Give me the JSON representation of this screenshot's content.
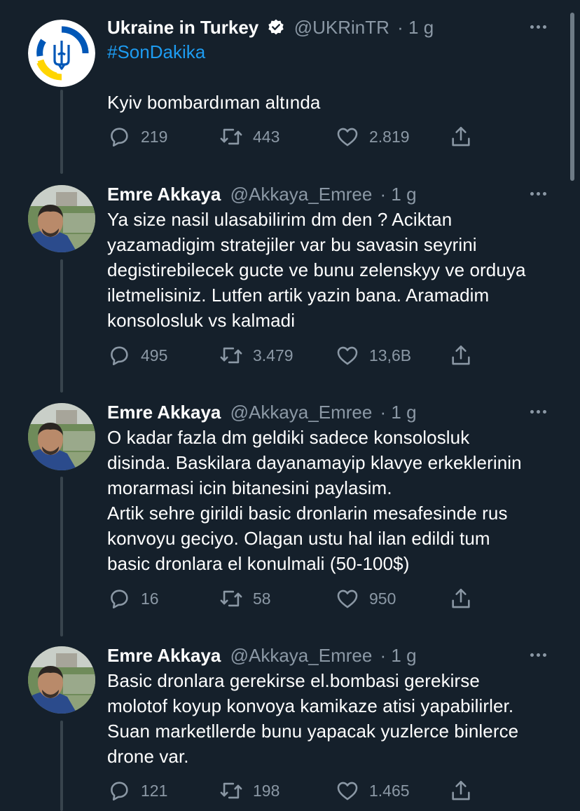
{
  "tweets": [
    {
      "author": "Ukraine in Turkey",
      "handle": "@UKRinTR",
      "time": "· 1 g",
      "verified": true,
      "hashtag": "#SonDakika",
      "text": "Kyiv bombardıman altında",
      "replies": "219",
      "retweets": "443",
      "likes": "2.819",
      "avatar": "ukraine-trident-icon"
    },
    {
      "author": "Emre Akkaya",
      "handle": "@Akkaya_Emree",
      "time": "· 1 g",
      "text": "Ya size nasil ulasabilirim dm den ? Aciktan\nyazamadigim stratejiler var bu savasin seyrini\ndegistirebilecek gucte ve bunu zelenskyy ve orduya\niletmelisiniz. Lutfen artik yazin bana.  Aramadim\nkonsolosluk vs kalmadi",
      "replies": "495",
      "retweets": "3.479",
      "likes": "13,6B"
    },
    {
      "author": "Emre Akkaya",
      "handle": "@Akkaya_Emree",
      "time": "· 1 g",
      "text": "O kadar fazla dm geldiki sadece konsolosluk\ndisinda. Baskilara dayanamayip klavye erkeklerinin\nmorarmasi icin bitanesini paylasim.\nArtik sehre girildi basic dronlarin mesafesinde rus\nkonvoyu geciyo. Olagan ustu hal ilan edildi tum\nbasic dronlara el konulmali (50-100$)",
      "replies": "16",
      "retweets": "58",
      "likes": "950"
    },
    {
      "author": "Emre Akkaya",
      "handle": "@Akkaya_Emree",
      "time": "· 1 g",
      "text": "Basic dronlara gerekirse el.bombasi gerekirse\nmolotof koyup konvoya kamikaze atisi yapabilirler.\nSuan marketllerde bunu yapacak yuzlerce binlerce\ndrone var.",
      "replies": "121",
      "retweets": "198",
      "likes": "1.465"
    }
  ],
  "colors": {
    "background": "#15202b",
    "text": "#ffffff",
    "muted": "#8b98a5",
    "link": "#1d9bf0",
    "thread_line": "#38444d",
    "ukraine_blue": "#0057b7",
    "ukraine_yellow": "#ffd500"
  }
}
